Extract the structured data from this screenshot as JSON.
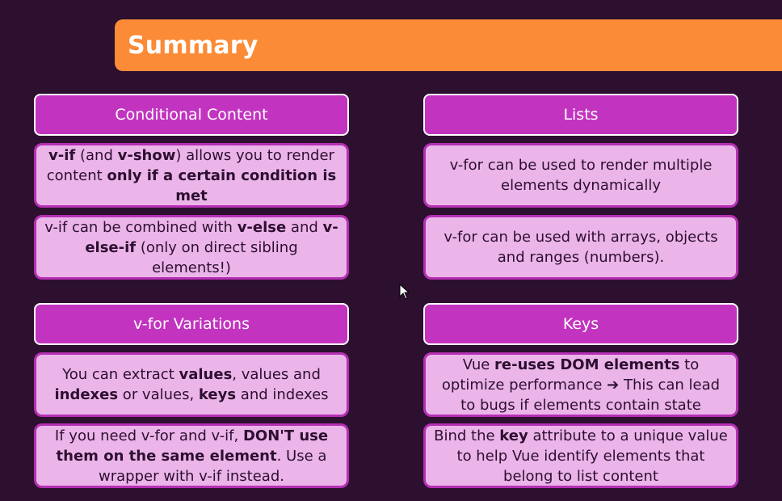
{
  "slide": {
    "title": "Summary",
    "sections": [
      {
        "header": "Conditional Content",
        "items": [
          [
            {
              "t": "v-if",
              "b": true
            },
            {
              "t": " (and ",
              "b": false
            },
            {
              "t": "v-show",
              "b": true
            },
            {
              "t": ") allows you to render content ",
              "b": false
            },
            {
              "t": "only if a certain condition is met",
              "b": true
            }
          ],
          [
            {
              "t": "v-if can be combined with ",
              "b": false
            },
            {
              "t": "v-else",
              "b": true
            },
            {
              "t": " and ",
              "b": false
            },
            {
              "t": "v-else-if",
              "b": true
            },
            {
              "t": " (only on direct sibling elements!)",
              "b": false
            }
          ]
        ]
      },
      {
        "header": "Lists",
        "items": [
          [
            {
              "t": "v-for can be used to render multiple elements dynamically",
              "b": false
            }
          ],
          [
            {
              "t": "v-for can be used with arrays, objects and ranges (numbers).",
              "b": false
            }
          ]
        ]
      },
      {
        "header": "v-for Variations",
        "items": [
          [
            {
              "t": "You can extract ",
              "b": false
            },
            {
              "t": "values",
              "b": true
            },
            {
              "t": ", values and ",
              "b": false
            },
            {
              "t": "indexes",
              "b": true
            },
            {
              "t": " or values, ",
              "b": false
            },
            {
              "t": "keys",
              "b": true
            },
            {
              "t": " and indexes",
              "b": false
            }
          ],
          [
            {
              "t": "If you need v-for and v-if, ",
              "b": false
            },
            {
              "t": "DON'T use them on the same element",
              "b": true
            },
            {
              "t": ". Use a wrapper with v-if instead.",
              "b": false
            }
          ]
        ]
      },
      {
        "header": "Keys",
        "items": [
          [
            {
              "t": "Vue ",
              "b": false
            },
            {
              "t": "re-uses DOM elements",
              "b": true
            },
            {
              "t": " to optimize performance ",
              "b": false
            },
            {
              "t": "➔",
              "b": true
            },
            {
              "t": " This can lead to bugs if elements contain state",
              "b": false
            }
          ],
          [
            {
              "t": "Bind the ",
              "b": false
            },
            {
              "t": "key",
              "b": true
            },
            {
              "t": " attribute to a unique value to help Vue identify elements that belong to list content",
              "b": false
            }
          ]
        ]
      }
    ]
  },
  "colors": {
    "background": "#2d0f2f",
    "title_bar": "#fb8b37",
    "header_fill": "#c234c0",
    "content_fill": "#ebb5ea",
    "content_border": "#b52fb3"
  },
  "icons": {
    "cursor": "mouse-pointer-icon"
  }
}
